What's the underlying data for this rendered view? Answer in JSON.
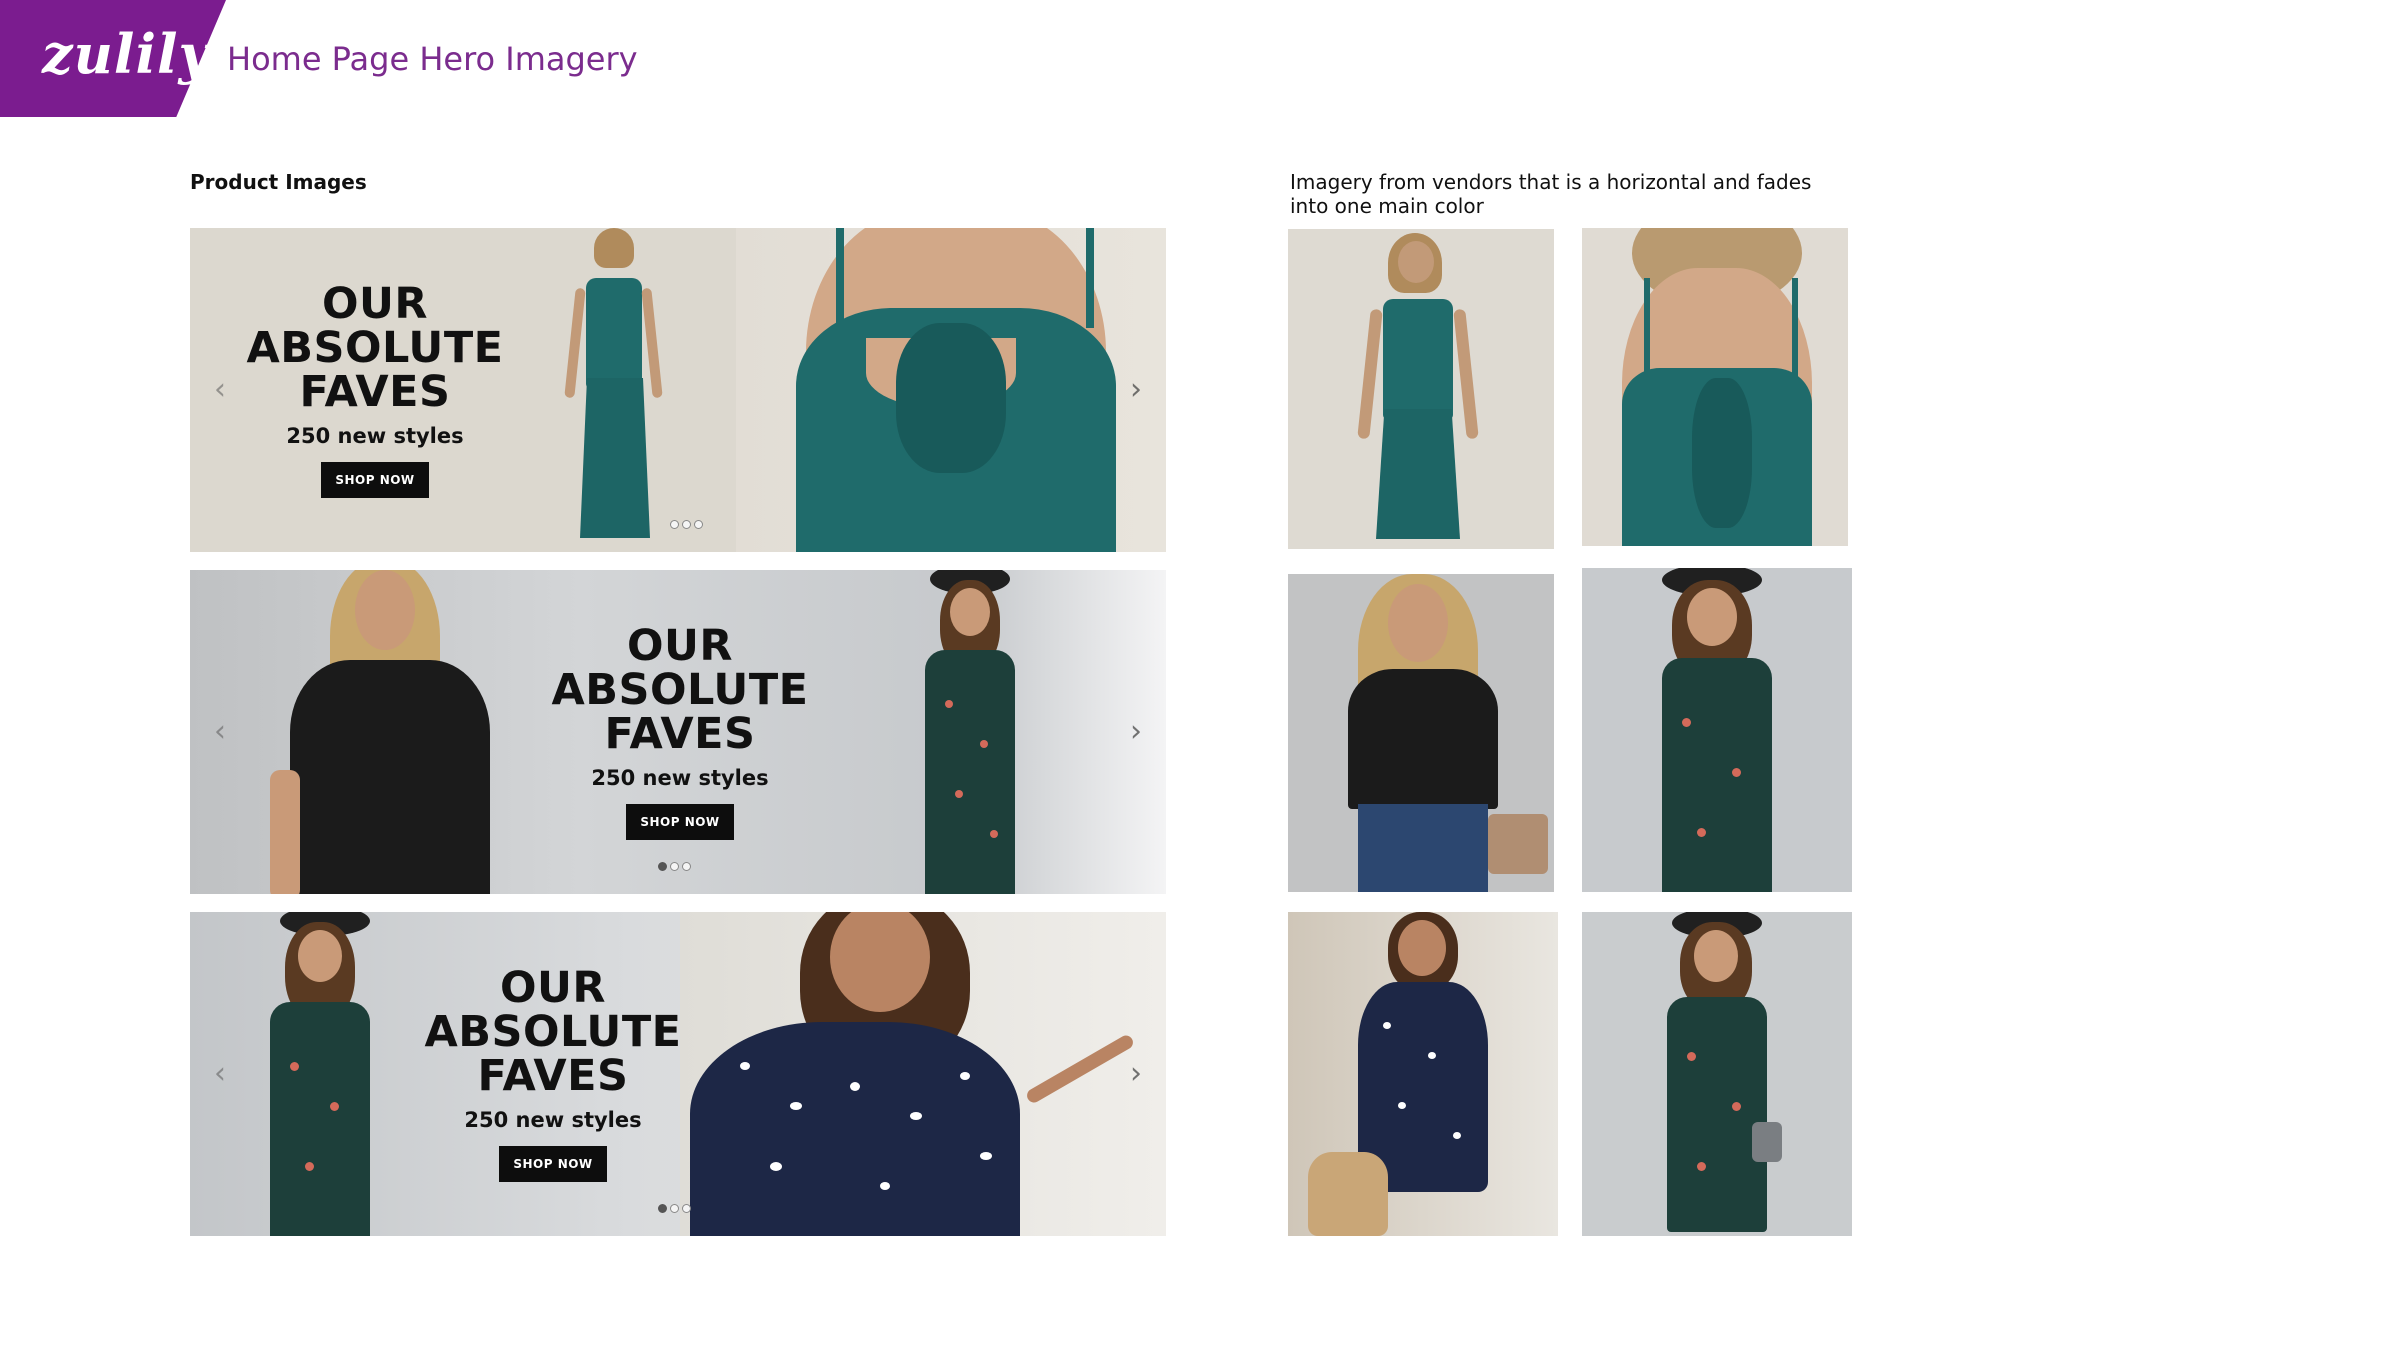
{
  "header": {
    "logo_text": "zulily",
    "title": "Home Page Hero Imagery",
    "brand_color": "#7b1c8f"
  },
  "sections": {
    "left_label": "Product Images",
    "right_label_line1": "Imagery from vendors that is a horizontal and fades",
    "right_label_line2": "into one main color"
  },
  "banners": [
    {
      "title": "OUR\nABSOLUTE\nFAVES",
      "subtitle": "250 new styles",
      "button": "SHOP NOW",
      "arrow_left": "‹",
      "arrow_right": "›",
      "active_dot": 0
    },
    {
      "title": "OUR\nABSOLUTE\nFAVES",
      "subtitle": "250 new styles",
      "button": "SHOP NOW",
      "arrow_left": "‹",
      "arrow_right": "›",
      "active_dot": 0
    },
    {
      "title": "OUR\nABSOLUTE\nFAVES",
      "subtitle": "250 new styles",
      "button": "SHOP NOW",
      "arrow_left": "‹",
      "arrow_right": "›",
      "active_dot": 0
    }
  ],
  "thumbnails": [
    {
      "subject": "teal-jumpsuit-front"
    },
    {
      "subject": "teal-jumpsuit-back-tie"
    },
    {
      "subject": "black-ruffle-top"
    },
    {
      "subject": "green-leopard-dress"
    },
    {
      "subject": "navy-dot-dress"
    },
    {
      "subject": "green-leopard-dress-full"
    }
  ],
  "colors": {
    "teal": "#1f6b6b",
    "black_top": "#1a1a1a",
    "leopard_green": "#1d3f3a",
    "navy_dot": "#1d2746",
    "wall_grey": "#c9ccd0",
    "beige_bg": "#dad6cd"
  }
}
